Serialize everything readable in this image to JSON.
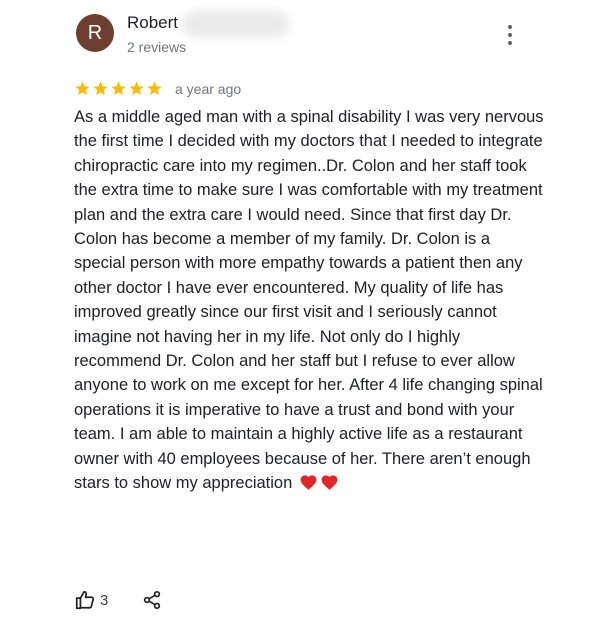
{
  "reviewer": {
    "initial": "R",
    "name": "Robert",
    "review_count": "2 reviews",
    "avatar_color": "#6d3f30"
  },
  "rating": {
    "stars": 5,
    "star_color": "#fbbc04",
    "time_ago": "a year ago"
  },
  "review_text": "As a middle aged man with a spinal disability I was very nervous the first time I decided with my doctors that I needed to integrate chiropractic care into my regimen..Dr. Colon and her staff took the extra time to make sure I was comfortable with my treatment plan and the extra care I would need. Since that first day Dr. Colon has become a member of my family. Dr. Colon is a special person with more empathy towards a patient then any other doctor I have ever encountered. My quality of life has improved greatly since our first visit and I seriously cannot imagine not having her in my life. Not only do I highly recommend Dr. Colon and her staff but I refuse to ever allow anyone to work on me except for her. After 4 life changing spinal operations it is imperative to have a trust and bond with your team. I am able to maintain a highly active life as a restaurant owner with 40 employees because of her. There aren’t enough stars to show my appreciation",
  "review_emoji": [
    "red-heart",
    "red-heart"
  ],
  "actions": {
    "like_count": "3",
    "like_icon": "thumbs-up-icon",
    "share_icon": "share-icon"
  },
  "menu_icon": "more-vertical-icon"
}
